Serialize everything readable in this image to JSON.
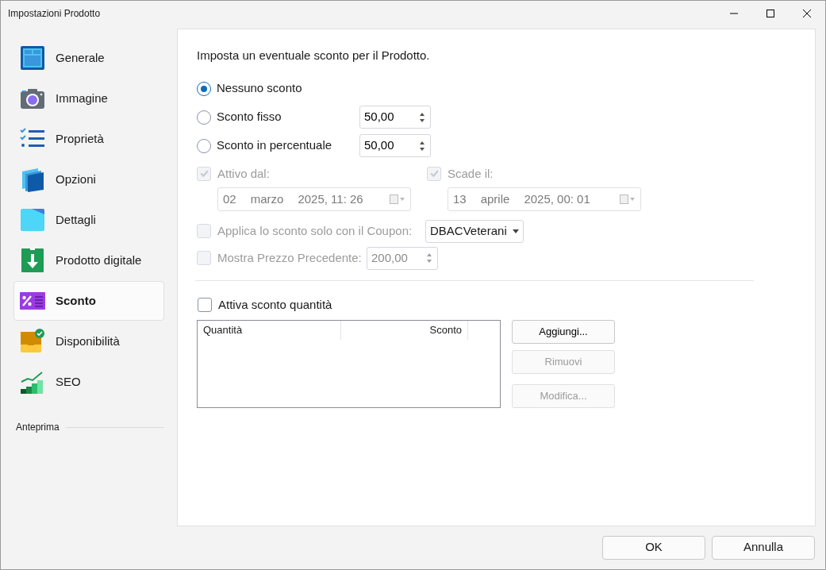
{
  "window": {
    "title": "Impostazioni Prodotto"
  },
  "sidebar": {
    "items": [
      {
        "label": "Generale",
        "selected": false
      },
      {
        "label": "Immagine",
        "selected": false
      },
      {
        "label": "Proprietà",
        "selected": false
      },
      {
        "label": "Opzioni",
        "selected": false
      },
      {
        "label": "Dettagli",
        "selected": false
      },
      {
        "label": "Prodotto digitale",
        "selected": false
      },
      {
        "label": "Sconto",
        "selected": true
      },
      {
        "label": "Disponibilità",
        "selected": false
      },
      {
        "label": "SEO",
        "selected": false
      }
    ],
    "section": "Anteprima"
  },
  "panel": {
    "heading": "Imposta un eventuale sconto per il Prodotto.",
    "discount_options": [
      {
        "label": "Nessuno sconto",
        "selected": true
      },
      {
        "label": "Sconto fisso",
        "selected": false,
        "value": "50,00"
      },
      {
        "label": "Sconto in percentuale",
        "selected": false,
        "value": "50,00"
      }
    ],
    "dates": [
      {
        "label": "Attivo dal:",
        "checked": true,
        "disabled": true,
        "day": "02",
        "month": "marzo",
        "time": "2025, 11: 26"
      },
      {
        "label": "Scade il:",
        "checked": true,
        "disabled": true,
        "day": "13",
        "month": "aprile",
        "time": "2025, 00: 01"
      }
    ],
    "coupon": {
      "label": "Applica lo sconto solo con il Coupon:",
      "checked": false,
      "disabled": true,
      "value": "DBACVeterani"
    },
    "previous_price": {
      "label": "Mostra Prezzo Precedente:",
      "checked": false,
      "disabled": true,
      "value": "200,00"
    },
    "quantity_discount": {
      "label": "Attiva sconto quantità",
      "checked": false,
      "table": {
        "columns": [
          "Quantità",
          "Sconto"
        ]
      },
      "buttons": [
        {
          "label": "Aggiungi...",
          "disabled": false
        },
        {
          "label": "Rimuovi",
          "disabled": true
        },
        {
          "label": "Modifica...",
          "disabled": true
        }
      ]
    }
  },
  "footer": {
    "buttons": [
      "OK",
      "Annulla"
    ]
  }
}
